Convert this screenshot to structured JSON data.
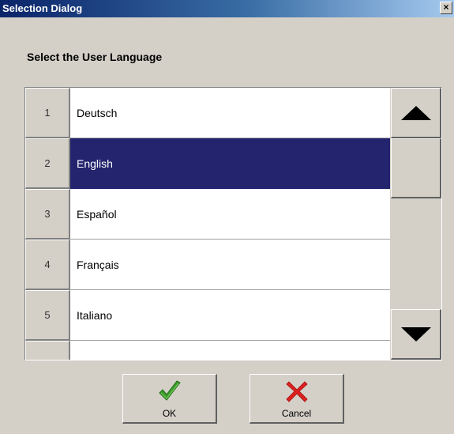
{
  "window": {
    "title": "Selection Dialog",
    "close_label": "×"
  },
  "heading": "Select the User Language",
  "list": {
    "items": [
      {
        "number": "1",
        "label": "Deutsch"
      },
      {
        "number": "2",
        "label": "English"
      },
      {
        "number": "3",
        "label": "Español"
      },
      {
        "number": "4",
        "label": "Français"
      },
      {
        "number": "5",
        "label": "Italiano"
      },
      {
        "number": "",
        "label": ""
      }
    ],
    "selected_number": "2"
  },
  "scrollbar": {
    "up_icon": "triangle-up-icon",
    "down_icon": "triangle-down-icon"
  },
  "buttons": {
    "ok": {
      "label": "OK",
      "icon": "checkmark-icon",
      "icon_color": "#3a9a28"
    },
    "cancel": {
      "label": "Cancel",
      "icon": "x-icon",
      "icon_color": "#e02020"
    }
  },
  "colors": {
    "selection": "#24246e",
    "face": "#d4d0c8",
    "titlebar_start": "#0a246a"
  }
}
